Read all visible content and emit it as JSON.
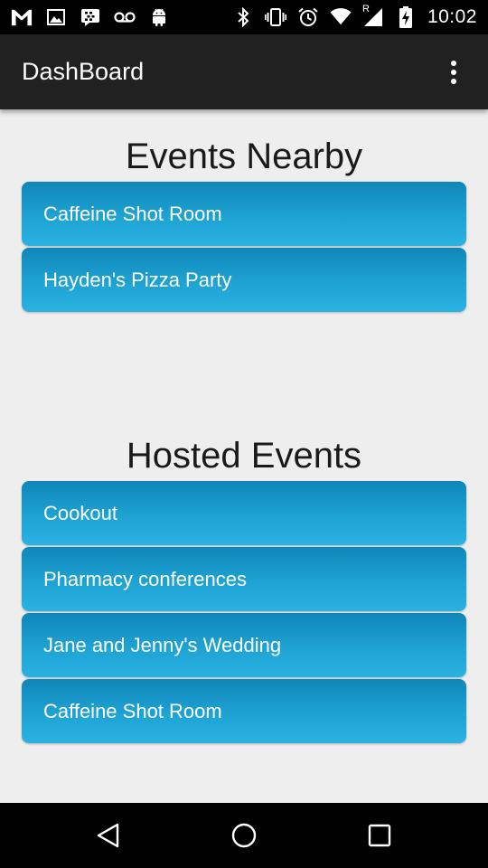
{
  "status_bar": {
    "time": "10:02",
    "left_icons": [
      "gmail-icon",
      "image-icon",
      "blackberry-messenger-icon",
      "voicemail-icon",
      "android-icon"
    ],
    "right_icons": [
      "bluetooth-icon",
      "vibrate-icon",
      "alarm-icon",
      "wifi-icon",
      "signal-roaming-icon",
      "battery-charging-icon"
    ],
    "signal_label": "R"
  },
  "app_bar": {
    "title": "DashBoard",
    "menu_icon": "more-vert-icon"
  },
  "events_nearby": {
    "title": "Events Nearby",
    "items": [
      {
        "label": "Caffeine Shot Room"
      },
      {
        "label": "Hayden's Pizza Party"
      }
    ]
  },
  "hosted_events": {
    "title": "Hosted Events",
    "items": [
      {
        "label": "Cookout"
      },
      {
        "label": "Pharmacy conferences"
      },
      {
        "label": "Jane and Jenny's Wedding"
      },
      {
        "label": "Caffeine Shot Room"
      }
    ]
  },
  "colors": {
    "item_top": "#0f86b8",
    "item_bottom": "#2ab2e2",
    "app_bar": "#212121",
    "background": "#eeeeee"
  },
  "nav_bar": {
    "icons": [
      "back-icon",
      "home-icon",
      "recents-icon"
    ]
  }
}
